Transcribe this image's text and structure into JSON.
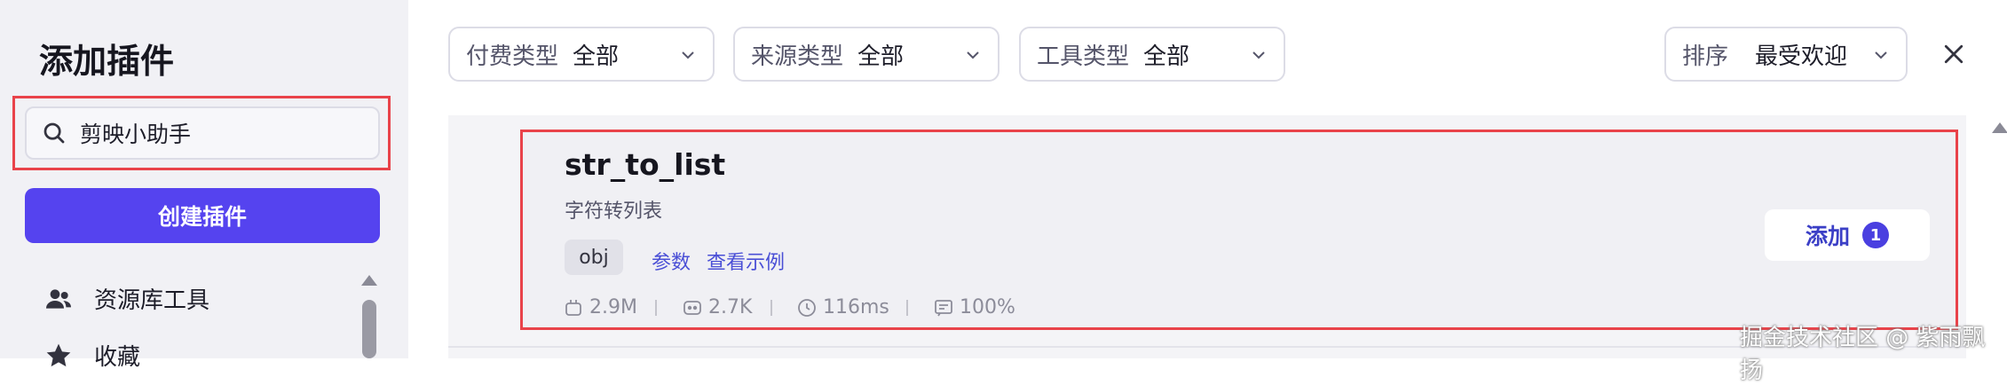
{
  "sidebar": {
    "title": "添加插件",
    "search": {
      "value": "剪映小助手"
    },
    "create_label": "创建插件",
    "items": [
      {
        "label": "资源库工具",
        "icon": "people-icon"
      },
      {
        "label": "收藏",
        "icon": "star-icon"
      }
    ]
  },
  "filters": [
    {
      "label": "付费类型",
      "value": "全部"
    },
    {
      "label": "来源类型",
      "value": "全部"
    },
    {
      "label": "工具类型",
      "value": "全部"
    }
  ],
  "sort": {
    "label": "排序",
    "value": "最受欢迎"
  },
  "card": {
    "title": "str_to_list",
    "description": "字符转列表",
    "tag": "obj",
    "links": [
      "参数",
      "查看示例"
    ],
    "stats": [
      {
        "icon": "plugin-icon",
        "value": "2.9M"
      },
      {
        "icon": "bot-icon",
        "value": "2.7K"
      },
      {
        "icon": "clock-icon",
        "value": "116ms"
      },
      {
        "icon": "rate-icon",
        "value": "100%"
      }
    ],
    "add_label": "添加",
    "add_badge": "1"
  },
  "watermark": "掘金技术社区 @ 紫雨飘扬",
  "colors": {
    "accent": "#5543ef",
    "highlight": "#e9434a",
    "link": "#4a4fd6"
  }
}
